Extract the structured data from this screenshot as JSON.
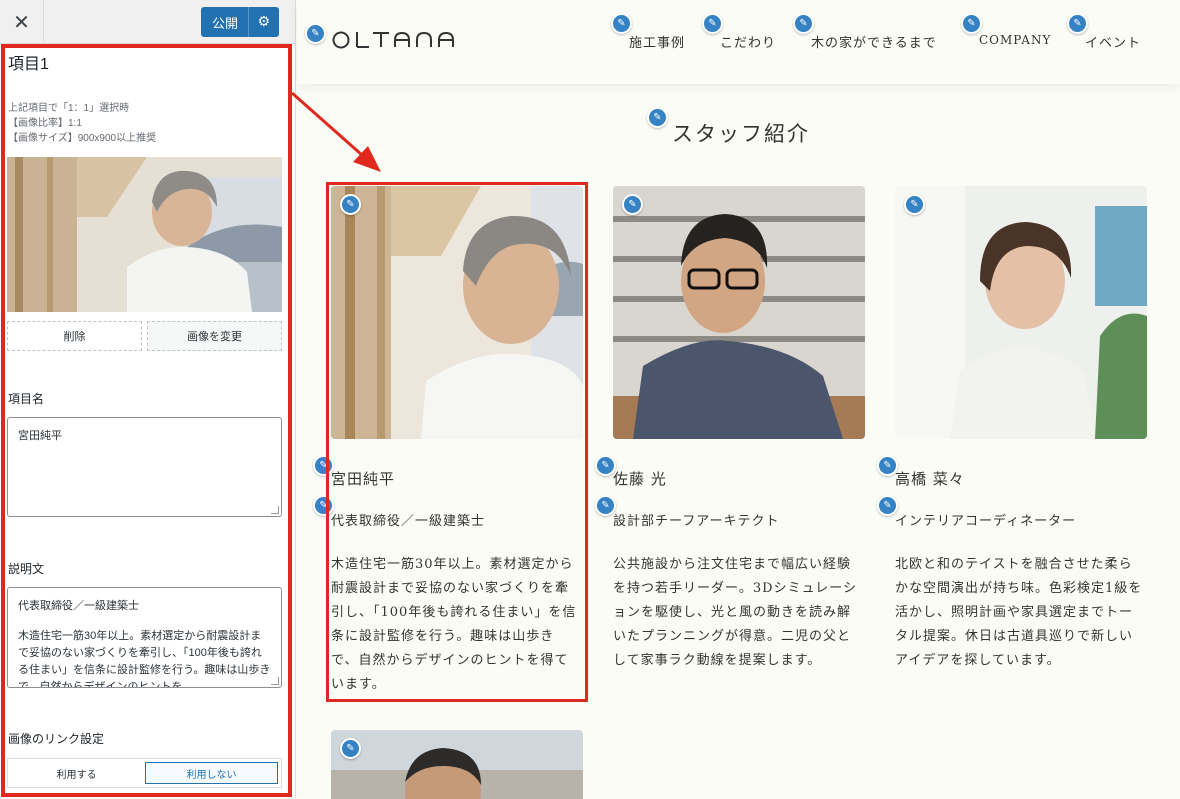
{
  "panel": {
    "close_icon": "close-icon",
    "publish_label": "公開",
    "settings_icon": "gear-icon",
    "item_title": "項目1",
    "note_line1": "上記項目で「1：1」選択時",
    "note_line2": "【画像比率】1:1",
    "note_line3": "【画像サイズ】900x900以上推奨",
    "remove_label": "削除",
    "change_image_label": "画像を変更",
    "name_label": "項目名",
    "name_value": "宮田純平",
    "desc_label": "説明文",
    "desc_value_line1": "代表取締役／一級建築士",
    "desc_value_line2": "木造住宅一筋30年以上。素材選定から耐震設計まで妥協のない家づくりを牽引し、「100年後も誇れる住まい」を信条に設計監修を行う。趣味は山歩きで、自然からデザインのヒントを",
    "link_label": "画像のリンク設定",
    "link_use": "利用する",
    "link_not_use": "利用しない",
    "accent_color": "#2271b1",
    "highlight_color": "#e1281e"
  },
  "site": {
    "logo": "OLTANA",
    "nav": [
      "施工事例",
      "こだわり",
      "木の家ができるまで",
      "COMPANY",
      "イベント"
    ],
    "section_title": "スタッフ紹介",
    "edit_icon": "pencil-icon",
    "staff": [
      {
        "name": "宮田純平",
        "role": "代表取締役／一級建築士",
        "desc": "木造住宅一筋30年以上。素材選定から耐震設計まで妥協のない家づくりを牽引し、「100年後も誇れる住まい」を信条に設計監修を行う。趣味は山歩きで、自然からデザインのヒントを得ています。"
      },
      {
        "name": "佐藤 光",
        "role": "設計部チーフアーキテクト",
        "desc": "公共施設から注文住宅まで幅広い経験を持つ若手リーダー。3Dシミュレーションを駆使し、光と風の動きを読み解いたプランニングが得意。二児の父として家事ラク動線を提案します。"
      },
      {
        "name": "高橋 菜々",
        "role": "インテリアコーディネーター",
        "desc": "北欧と和のテイストを融合させた柔らかな空間演出が持ち味。色彩検定1級を活かし、照明計画や家具選定までトータル提案。休日は古道具巡りで新しいアイデアを探しています。"
      }
    ]
  }
}
